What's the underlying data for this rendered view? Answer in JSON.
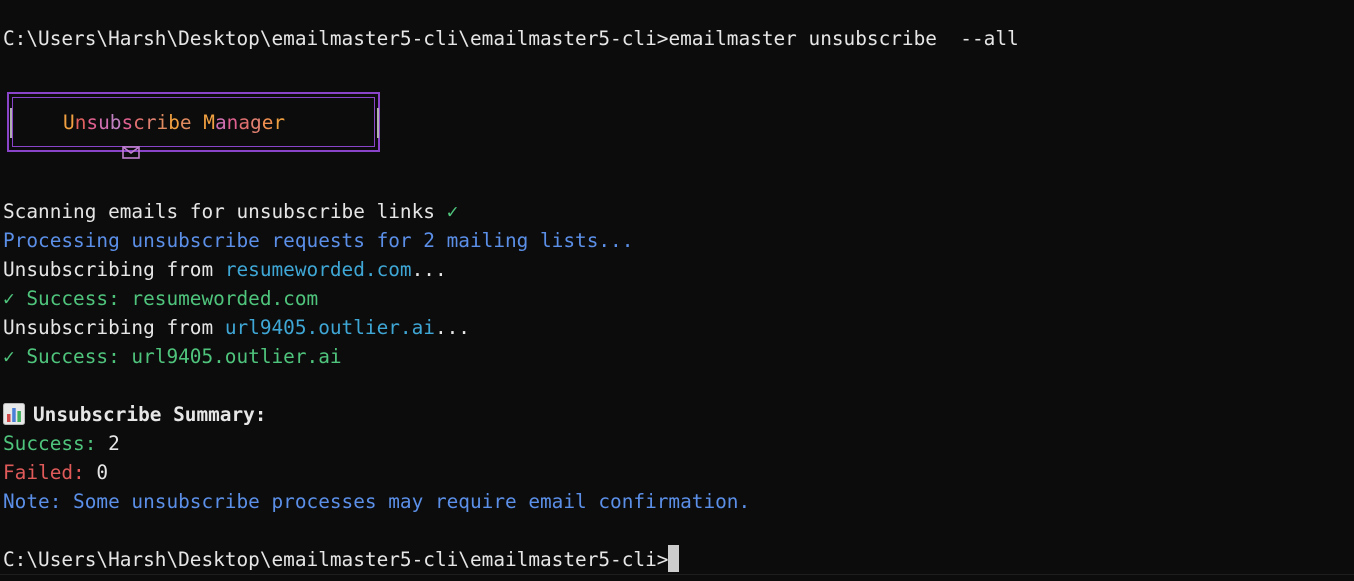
{
  "prompt1": {
    "path": "C:\\Users\\Harsh\\Desktop\\emailmaster5-cli\\emailmaster5-cli>",
    "command": "emailmaster unsubscribe  --all"
  },
  "banner": {
    "icon": "envelope-icon",
    "title_letters": [
      "U",
      "n",
      "s",
      "u",
      "b",
      "s",
      "c",
      "r",
      "i",
      "b",
      "e",
      " ",
      "M",
      "a",
      "n",
      "a",
      "g",
      "e",
      "r"
    ],
    "title_colors": [
      "#f0a040",
      "#e06060",
      "#e06090",
      "#d070b0",
      "#c080c0",
      "#e06090",
      "#e07070",
      "#e08070",
      "#e08a60",
      "#f0a040",
      "#e08a60",
      " ",
      "#f0a040",
      "#d070b0",
      "#e06090",
      "#e07070",
      "#e08070",
      "#f09050",
      "#f0a040"
    ]
  },
  "lines": {
    "scanning": "Scanning emails for unsubscribe links",
    "scanning_check": "✓",
    "processing": "Processing unsubscribe requests for 2 mailing lists...",
    "unsub_prefix_1": "Unsubscribing from ",
    "unsub_domain_1": "resumeworded.com",
    "unsub_suffix_1": "...",
    "success_1": "✓ Success: resumeworded.com",
    "unsub_prefix_2": "Unsubscribing from ",
    "unsub_domain_2": "url9405.outlier.ai",
    "unsub_suffix_2": "...",
    "success_2": "✓ Success: url9405.outlier.ai"
  },
  "summary": {
    "icon": "bar-chart-icon",
    "heading": "Unsubscribe Summary:",
    "success_label": "Success:",
    "success_value": "2",
    "failed_label": "Failed:",
    "failed_value": "0",
    "note": "Note: Some unsubscribe processes may require email confirmation."
  },
  "prompt2": {
    "path": "C:\\Users\\Harsh\\Desktop\\emailmaster5-cli\\emailmaster5-cli>"
  },
  "colors": {
    "background": "#0c0c0c",
    "text": "#cccccc",
    "blue": "#5b8fe8",
    "cyan": "#3fa7d6",
    "green": "#4fc47c",
    "red": "#e05a5a",
    "banner_border": "#8a44c9"
  }
}
